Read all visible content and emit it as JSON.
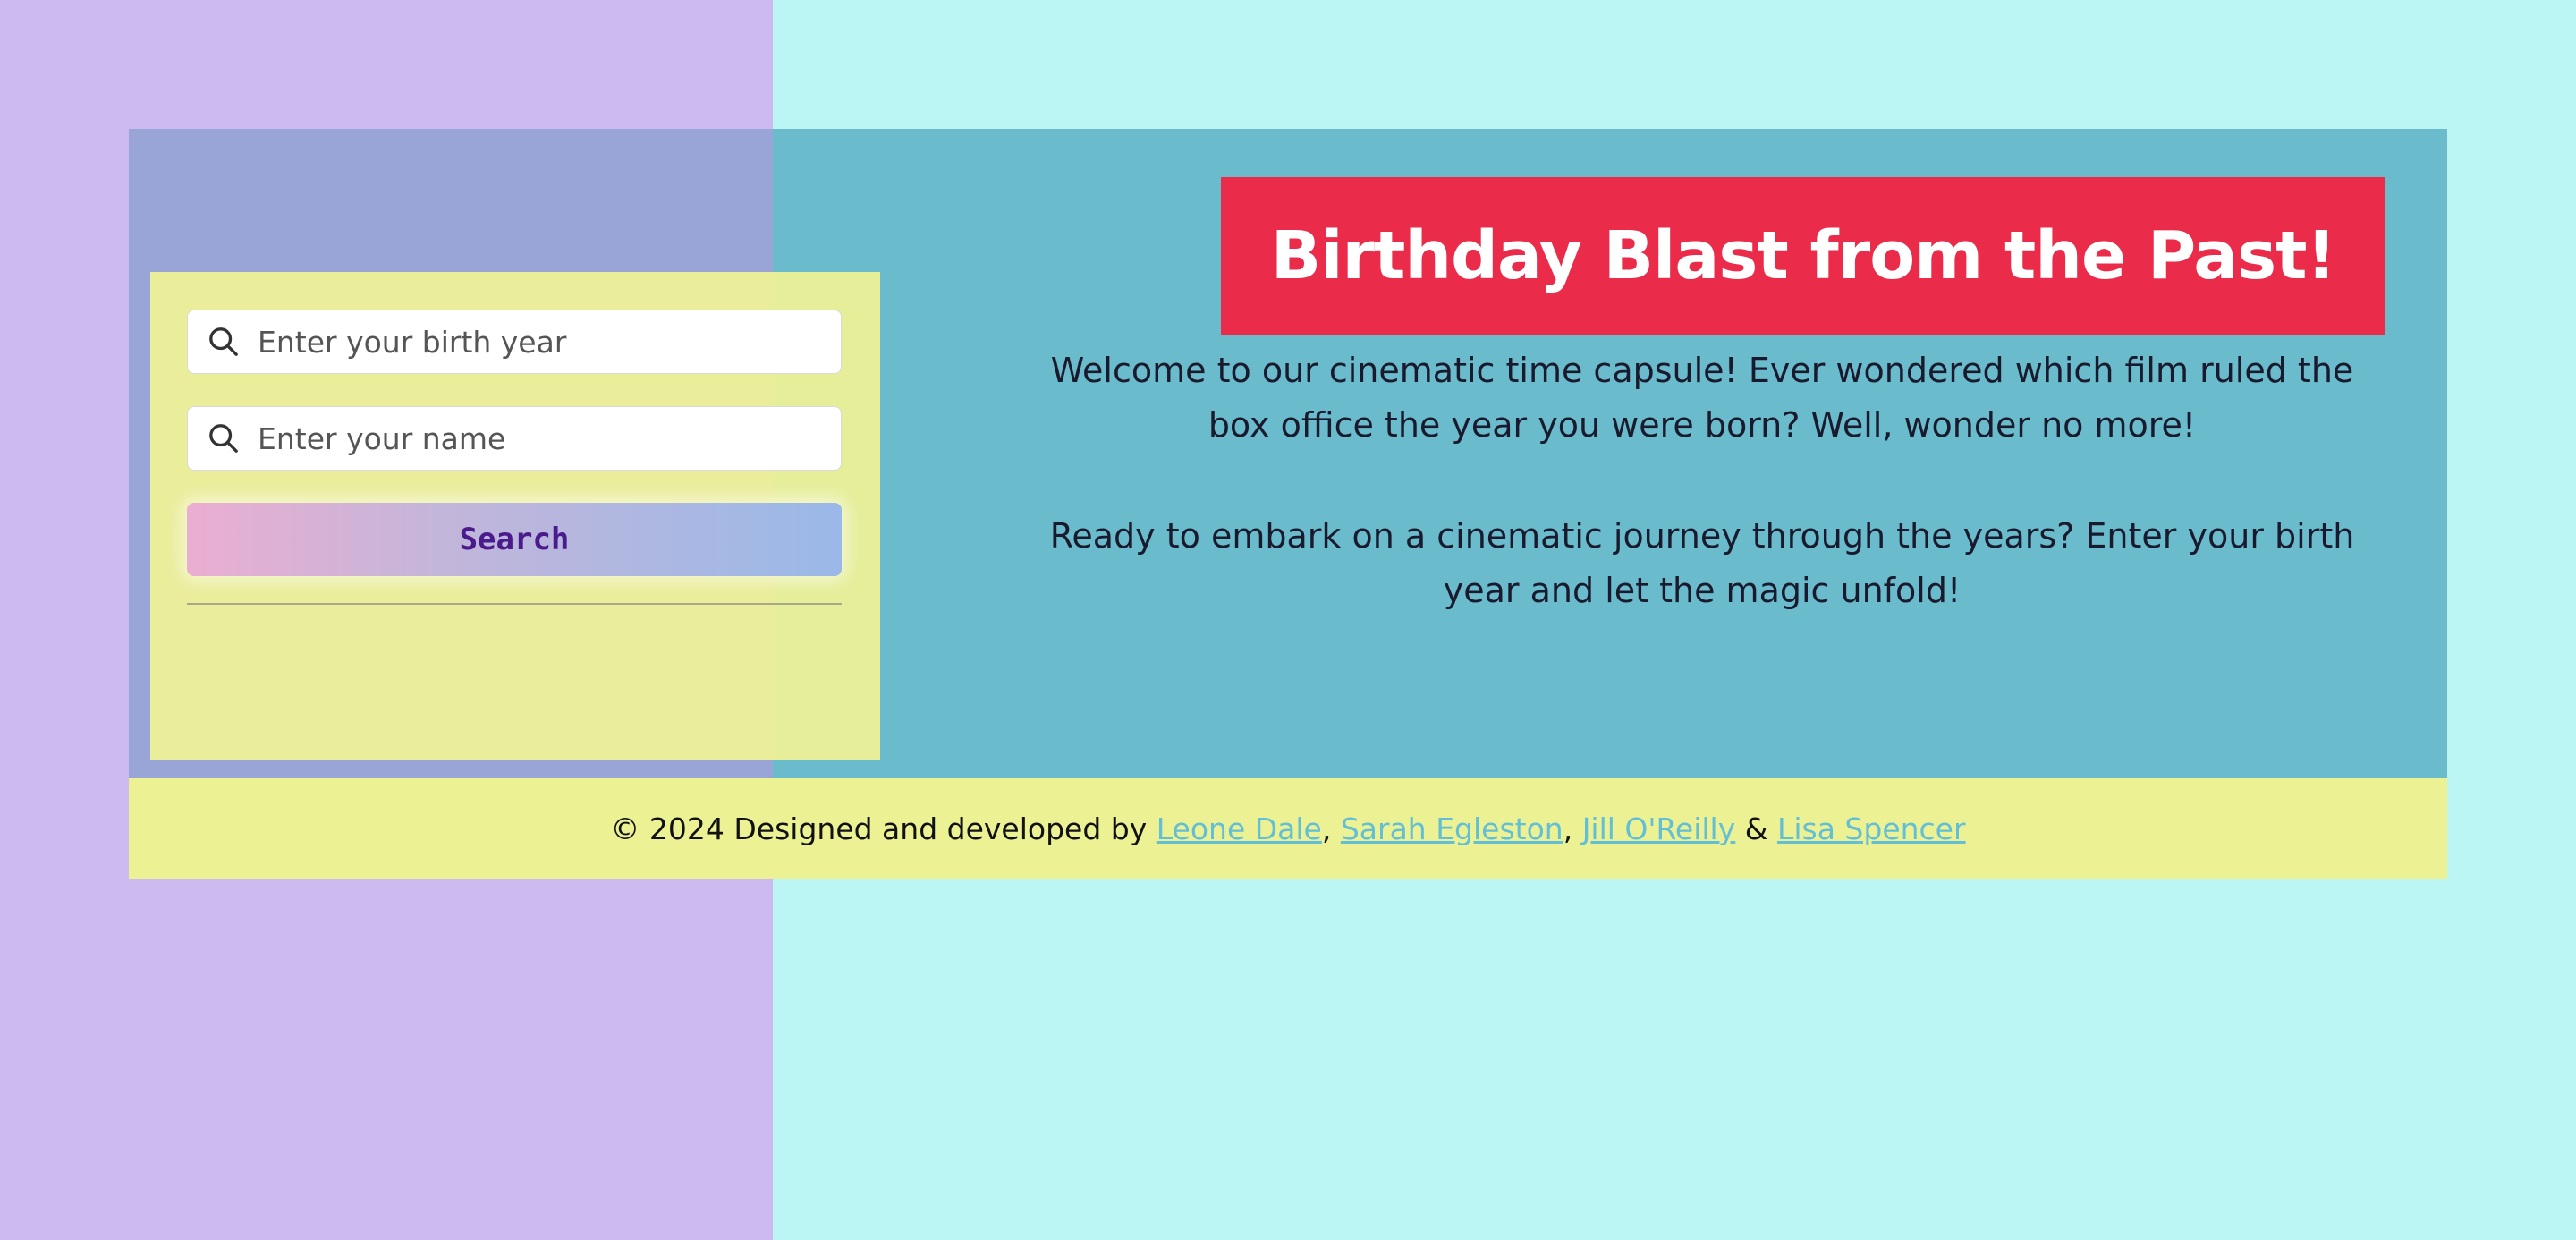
{
  "header": {
    "title": "Birthday Blast from the Past!"
  },
  "search_form": {
    "birth_year_placeholder": "Enter your birth year",
    "name_placeholder": "Enter your name",
    "search_button_label": "Search",
    "field_icon": "search-icon"
  },
  "intro": {
    "paragraph_1": "Welcome to our cinematic time capsule! Ever wondered which film ruled the box office the year you were born? Well, wonder no more!",
    "paragraph_2": "Ready to embark on a cinematic journey through the years? Enter your birth year and let the magic unfold!"
  },
  "footer": {
    "prefix": "© 2024 Designed and developed by ",
    "sep_1": ", ",
    "sep_2": ", ",
    "sep_3": " & ",
    "authors": [
      {
        "name": "Leone Dale"
      },
      {
        "name": "Sarah Egleston"
      },
      {
        "name": "Jill O'Reilly"
      },
      {
        "name": "Lisa Spencer"
      }
    ]
  },
  "colors": {
    "left_background": "#cdbaf1",
    "right_background": "#bbf6f5",
    "title_banner": "#ea2c4a",
    "search_card": "#f0f296",
    "footer_background": "#ecf194",
    "link": "#63bfd6",
    "search_button_text": "#4b1a8c"
  }
}
